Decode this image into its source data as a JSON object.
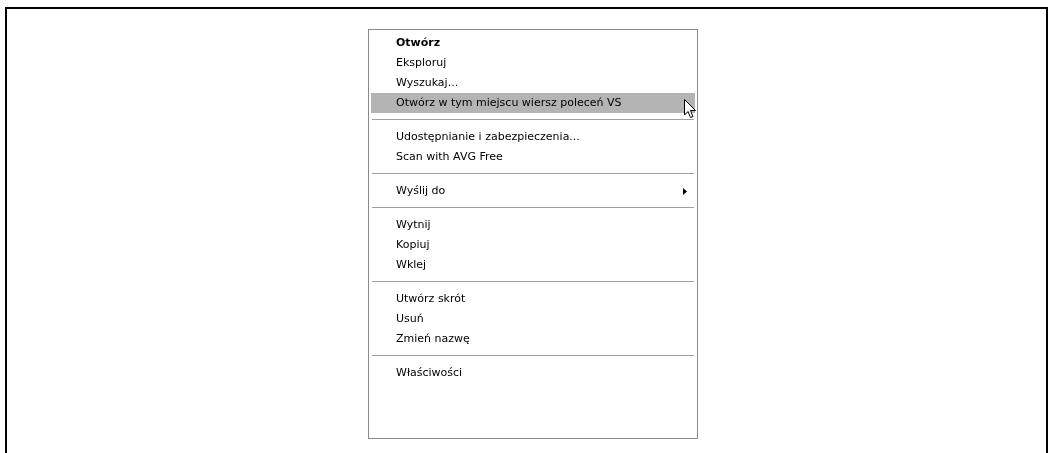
{
  "context_menu": {
    "groups": [
      {
        "items": [
          {
            "label": "Otwórz",
            "default": true,
            "selected": false,
            "submenu": false
          },
          {
            "label": "Eksploruj",
            "default": false,
            "selected": false,
            "submenu": false
          },
          {
            "label": "Wyszukaj...",
            "default": false,
            "selected": false,
            "submenu": false
          },
          {
            "label": "Otwórz w tym miejscu wiersz poleceń VS",
            "default": false,
            "selected": true,
            "submenu": false
          }
        ]
      },
      {
        "items": [
          {
            "label": "Udostępnianie i zabezpieczenia...",
            "default": false,
            "selected": false,
            "submenu": false
          },
          {
            "label": "Scan with AVG Free",
            "default": false,
            "selected": false,
            "submenu": false
          }
        ]
      },
      {
        "items": [
          {
            "label": "Wyślij do",
            "default": false,
            "selected": false,
            "submenu": true
          }
        ]
      },
      {
        "items": [
          {
            "label": "Wytnij",
            "default": false,
            "selected": false,
            "submenu": false
          },
          {
            "label": "Kopiuj",
            "default": false,
            "selected": false,
            "submenu": false
          },
          {
            "label": "Wklej",
            "default": false,
            "selected": false,
            "submenu": false
          }
        ]
      },
      {
        "items": [
          {
            "label": "Utwórz skrót",
            "default": false,
            "selected": false,
            "submenu": false
          },
          {
            "label": "Usuń",
            "default": false,
            "selected": false,
            "submenu": false
          },
          {
            "label": "Zmień nazwę",
            "default": false,
            "selected": false,
            "submenu": false
          }
        ]
      },
      {
        "items": [
          {
            "label": "Właściwości",
            "default": false,
            "selected": false,
            "submenu": false
          }
        ]
      }
    ]
  }
}
